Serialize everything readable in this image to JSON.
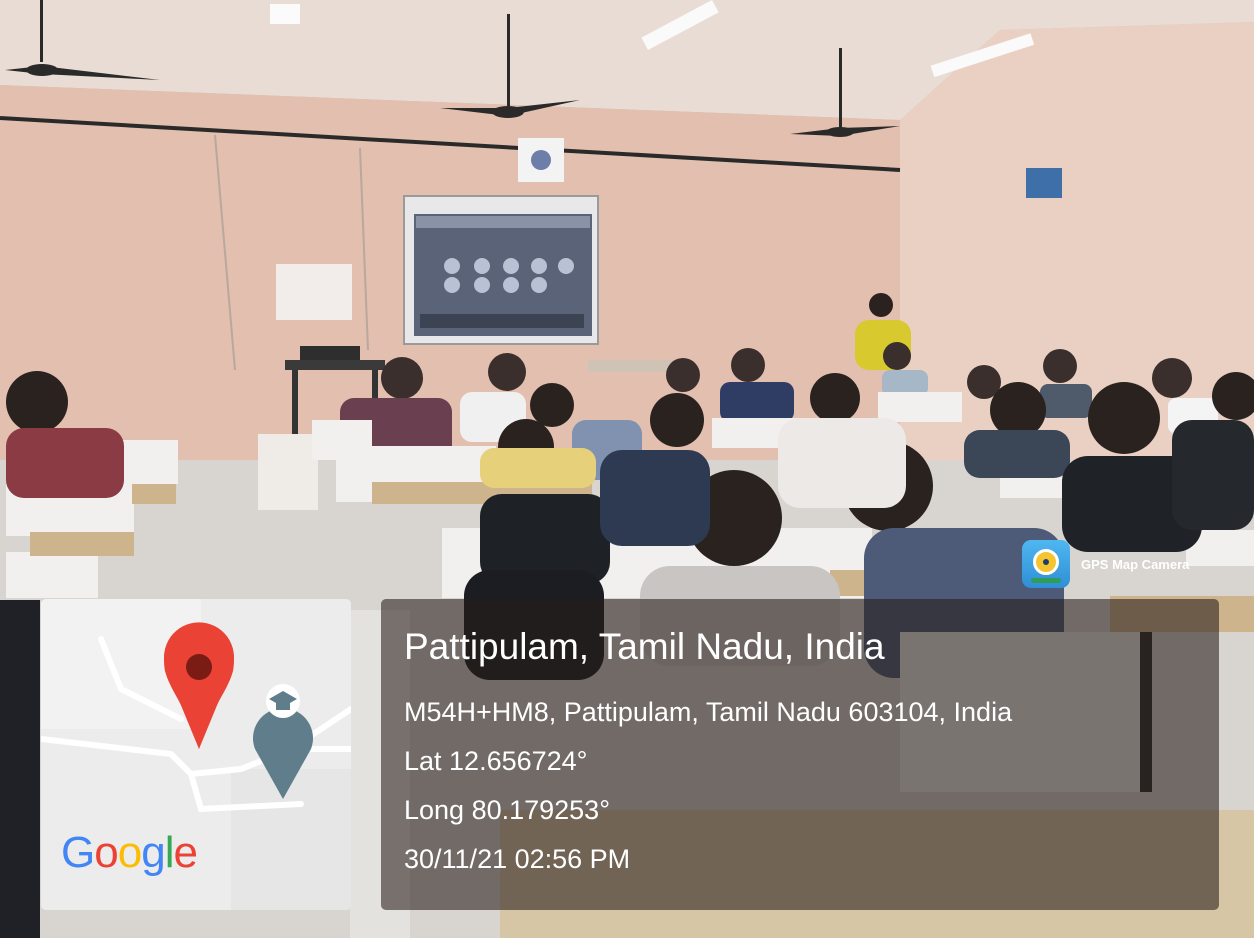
{
  "photo": {
    "subject": "classroom-with-students-facing-projector-screen"
  },
  "app_badge": {
    "label": "GPS Map Camera",
    "icon": "gps-map-camera-app-icon"
  },
  "map": {
    "logo_text": "Google",
    "pin_icon": "location-pin-icon",
    "poi_icon": "school-poi-icon"
  },
  "location": {
    "title": "Pattipulam, Tamil Nadu, India",
    "address": "M54H+HM8, Pattipulam, Tamil Nadu 603104, India",
    "latitude": "Lat 12.656724°",
    "longitude": "Long 80.179253°",
    "timestamp": "30/11/21 02:56 PM"
  },
  "colors": {
    "pin_red": "#ea4335",
    "pin_dark": "#7a1b14",
    "poi_grey": "#607d8b",
    "panel_overlay": "rgba(40,30,26,0.58)"
  }
}
